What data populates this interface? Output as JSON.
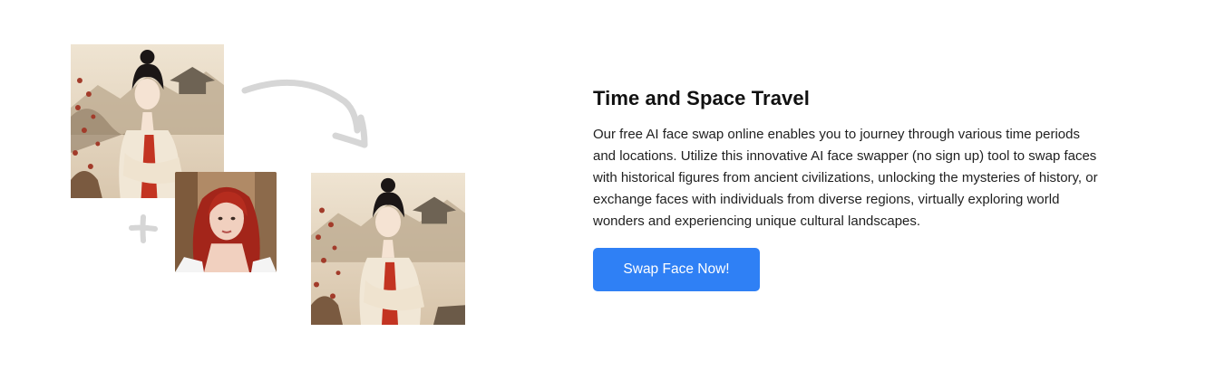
{
  "section": {
    "title": "Time and Space Travel",
    "description": "Our free AI face swap online enables you to journey through various time periods and locations. Utilize this innovative AI face swapper (no sign up) tool to swap faces with historical figures from ancient civilizations, unlocking the mysteries of history, or exchange faces with individuals from diverse regions, virtually exploring world wonders and experiencing unique cultural landscapes.",
    "cta_label": "Swap Face Now!"
  },
  "illustration": {
    "images": [
      "source-historical-portrait",
      "face-photo-red-hair",
      "result-historical-portrait"
    ],
    "icons": [
      "plus-icon",
      "curved-arrow-icon"
    ]
  },
  "colors": {
    "accent": "#2f80f5",
    "background": "#ffffff",
    "decor_gray": "#d6d6d6"
  }
}
